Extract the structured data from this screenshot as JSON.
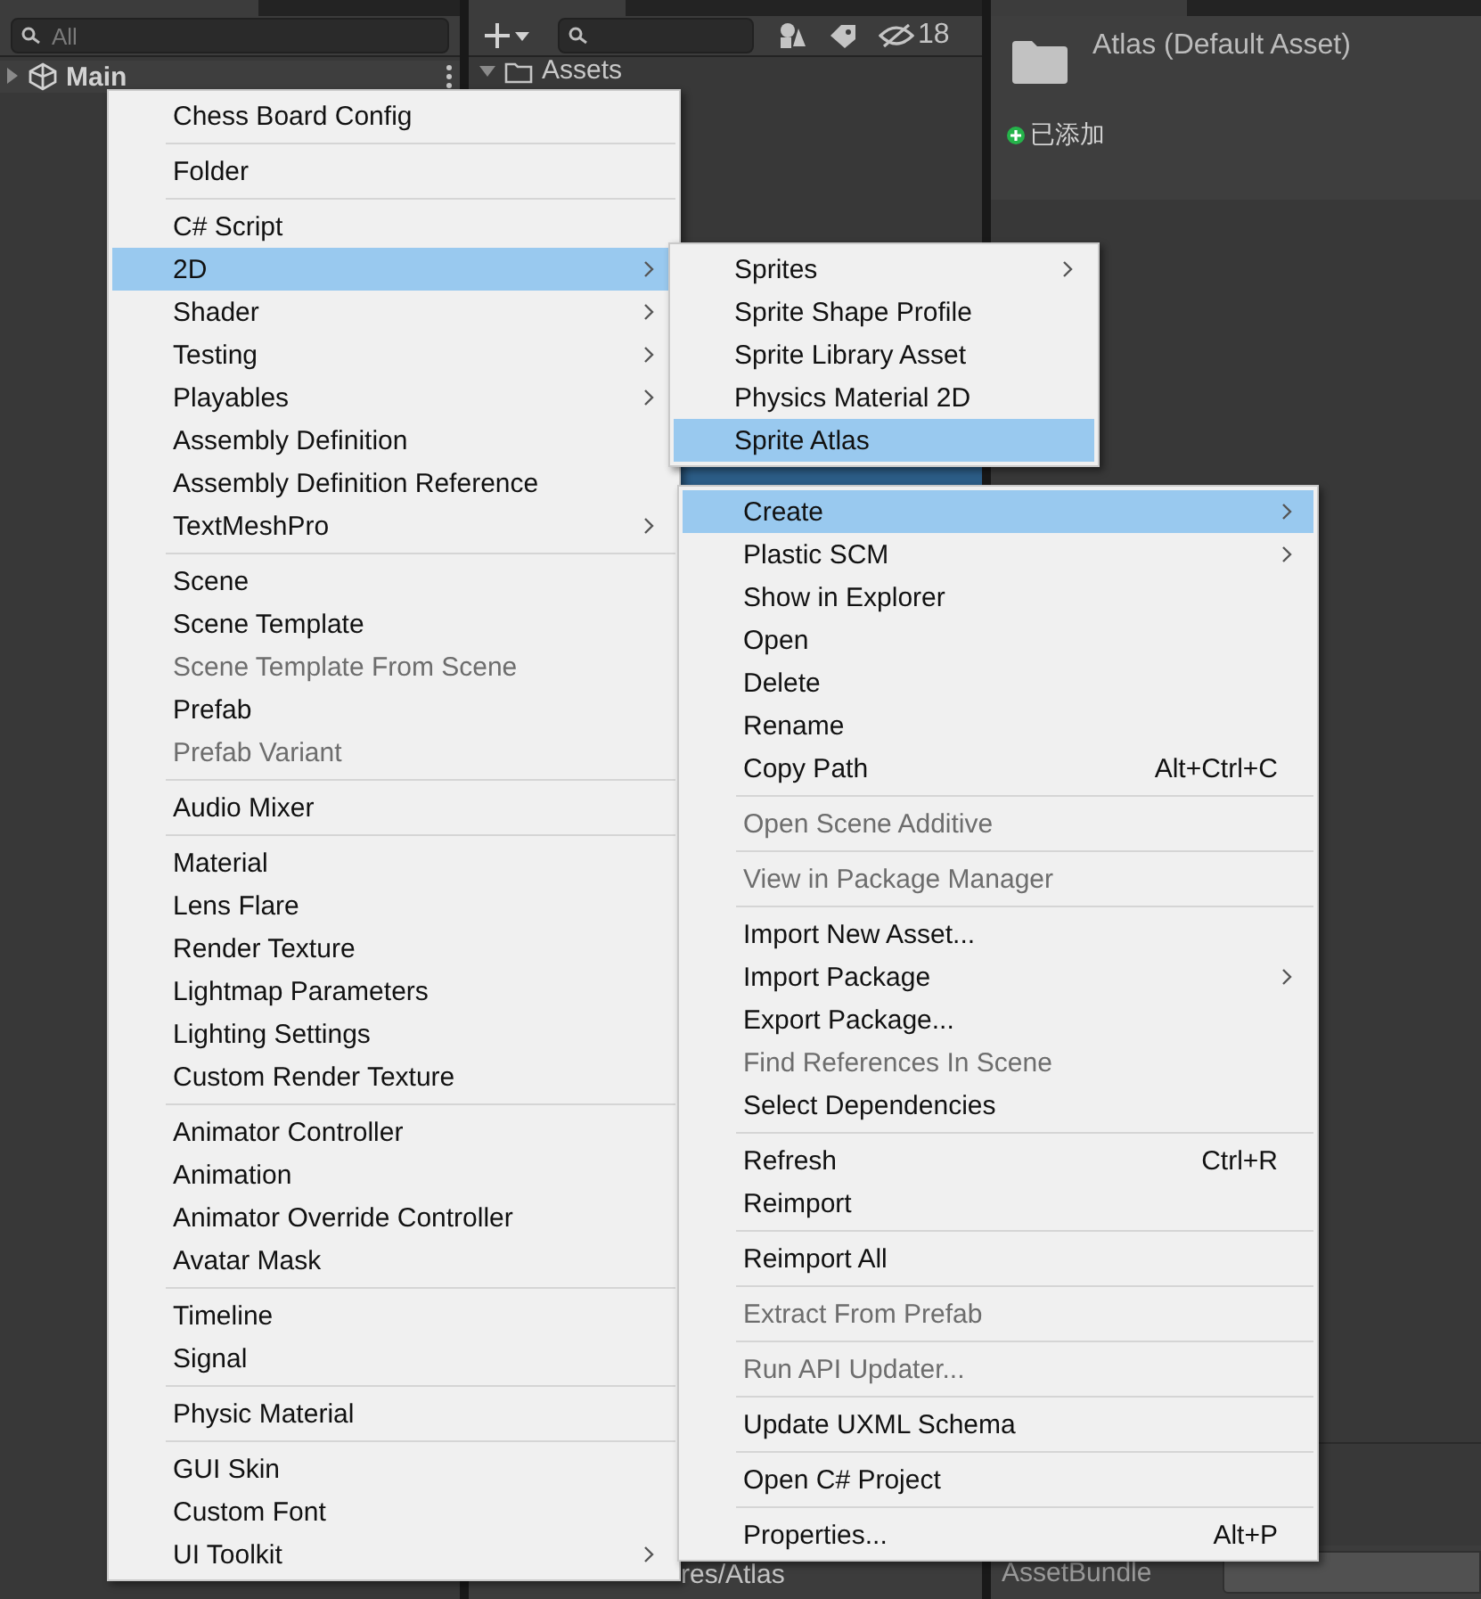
{
  "hierarchy": {
    "search": {
      "placeholder": "All"
    },
    "rows": [
      {
        "label": "Main",
        "expanded": false
      }
    ]
  },
  "project": {
    "toolbar": {
      "hidden_count": "18"
    },
    "tree": [
      {
        "label": "Assets",
        "expanded": true
      }
    ],
    "path": "res/Atlas"
  },
  "inspector": {
    "title": "Atlas (Default Asset)",
    "status": "已添加",
    "bundle_label": "AssetBundle"
  },
  "main_menu": {
    "groups": [
      {
        "items": [
          {
            "label": "Chess Board Config",
            "selected": false,
            "disabled": false,
            "submenu": false
          }
        ]
      },
      {
        "items": [
          {
            "label": "Folder",
            "selected": false,
            "disabled": false,
            "submenu": false
          }
        ]
      },
      {
        "items": [
          {
            "label": "C# Script",
            "selected": false,
            "disabled": false,
            "submenu": false
          },
          {
            "label": "2D",
            "selected": true,
            "disabled": false,
            "submenu": true
          },
          {
            "label": "Shader",
            "selected": false,
            "disabled": false,
            "submenu": true
          },
          {
            "label": "Testing",
            "selected": false,
            "disabled": false,
            "submenu": true
          },
          {
            "label": "Playables",
            "selected": false,
            "disabled": false,
            "submenu": true
          },
          {
            "label": "Assembly Definition",
            "selected": false,
            "disabled": false,
            "submenu": false
          },
          {
            "label": "Assembly Definition Reference",
            "selected": false,
            "disabled": false,
            "submenu": false
          },
          {
            "label": "TextMeshPro",
            "selected": false,
            "disabled": false,
            "submenu": true
          }
        ]
      },
      {
        "items": [
          {
            "label": "Scene",
            "selected": false,
            "disabled": false,
            "submenu": false
          },
          {
            "label": "Scene Template",
            "selected": false,
            "disabled": false,
            "submenu": false
          },
          {
            "label": "Scene Template From Scene",
            "selected": false,
            "disabled": true,
            "submenu": false
          },
          {
            "label": "Prefab",
            "selected": false,
            "disabled": false,
            "submenu": false
          },
          {
            "label": "Prefab Variant",
            "selected": false,
            "disabled": true,
            "submenu": false
          }
        ]
      },
      {
        "items": [
          {
            "label": "Audio Mixer",
            "selected": false,
            "disabled": false,
            "submenu": false
          }
        ]
      },
      {
        "items": [
          {
            "label": "Material",
            "selected": false,
            "disabled": false,
            "submenu": false
          },
          {
            "label": "Lens Flare",
            "selected": false,
            "disabled": false,
            "submenu": false
          },
          {
            "label": "Render Texture",
            "selected": false,
            "disabled": false,
            "submenu": false
          },
          {
            "label": "Lightmap Parameters",
            "selected": false,
            "disabled": false,
            "submenu": false
          },
          {
            "label": "Lighting Settings",
            "selected": false,
            "disabled": false,
            "submenu": false
          },
          {
            "label": "Custom Render Texture",
            "selected": false,
            "disabled": false,
            "submenu": false
          }
        ]
      },
      {
        "items": [
          {
            "label": "Animator Controller",
            "selected": false,
            "disabled": false,
            "submenu": false
          },
          {
            "label": "Animation",
            "selected": false,
            "disabled": false,
            "submenu": false
          },
          {
            "label": "Animator Override Controller",
            "selected": false,
            "disabled": false,
            "submenu": false
          },
          {
            "label": "Avatar Mask",
            "selected": false,
            "disabled": false,
            "submenu": false
          }
        ]
      },
      {
        "items": [
          {
            "label": "Timeline",
            "selected": false,
            "disabled": false,
            "submenu": false
          },
          {
            "label": "Signal",
            "selected": false,
            "disabled": false,
            "submenu": false
          }
        ]
      },
      {
        "items": [
          {
            "label": "Physic Material",
            "selected": false,
            "disabled": false,
            "submenu": false
          }
        ]
      },
      {
        "items": [
          {
            "label": "GUI Skin",
            "selected": false,
            "disabled": false,
            "submenu": false
          },
          {
            "label": "Custom Font",
            "selected": false,
            "disabled": false,
            "submenu": false
          },
          {
            "label": "UI Toolkit",
            "selected": false,
            "disabled": false,
            "submenu": true
          }
        ]
      }
    ]
  },
  "submenu_2d": {
    "groups": [
      {
        "items": [
          {
            "label": "Sprites",
            "selected": false,
            "disabled": false,
            "submenu": true
          },
          {
            "label": "Sprite Shape Profile",
            "selected": false,
            "disabled": false,
            "submenu": false
          },
          {
            "label": "Sprite Library Asset",
            "selected": false,
            "disabled": false,
            "submenu": false
          },
          {
            "label": "Physics Material 2D",
            "selected": false,
            "disabled": false,
            "submenu": false
          },
          {
            "label": "Sprite Atlas",
            "selected": true,
            "disabled": false,
            "submenu": false
          }
        ]
      }
    ]
  },
  "context_menu": {
    "groups": [
      {
        "items": [
          {
            "label": "Create",
            "selected": true,
            "disabled": false,
            "submenu": true
          },
          {
            "label": "Plastic SCM",
            "selected": false,
            "disabled": false,
            "submenu": true
          },
          {
            "label": "Show in Explorer",
            "selected": false,
            "disabled": false,
            "submenu": false
          },
          {
            "label": "Open",
            "selected": false,
            "disabled": false,
            "submenu": false
          },
          {
            "label": "Delete",
            "selected": false,
            "disabled": false,
            "submenu": false
          },
          {
            "label": "Rename",
            "selected": false,
            "disabled": false,
            "submenu": false
          },
          {
            "label": "Copy Path",
            "selected": false,
            "disabled": false,
            "submenu": false,
            "shortcut": "Alt+Ctrl+C"
          }
        ]
      },
      {
        "items": [
          {
            "label": "Open Scene Additive",
            "selected": false,
            "disabled": true,
            "submenu": false
          }
        ]
      },
      {
        "items": [
          {
            "label": "View in Package Manager",
            "selected": false,
            "disabled": true,
            "submenu": false
          }
        ]
      },
      {
        "items": [
          {
            "label": "Import New Asset...",
            "selected": false,
            "disabled": false,
            "submenu": false
          },
          {
            "label": "Import Package",
            "selected": false,
            "disabled": false,
            "submenu": true
          },
          {
            "label": "Export Package...",
            "selected": false,
            "disabled": false,
            "submenu": false
          },
          {
            "label": "Find References In Scene",
            "selected": false,
            "disabled": true,
            "submenu": false
          },
          {
            "label": "Select Dependencies",
            "selected": false,
            "disabled": false,
            "submenu": false
          }
        ]
      },
      {
        "items": [
          {
            "label": "Refresh",
            "selected": false,
            "disabled": false,
            "submenu": false,
            "shortcut": "Ctrl+R"
          },
          {
            "label": "Reimport",
            "selected": false,
            "disabled": false,
            "submenu": false
          }
        ]
      },
      {
        "items": [
          {
            "label": "Reimport All",
            "selected": false,
            "disabled": false,
            "submenu": false
          }
        ]
      },
      {
        "items": [
          {
            "label": "Extract From Prefab",
            "selected": false,
            "disabled": true,
            "submenu": false
          }
        ]
      },
      {
        "items": [
          {
            "label": "Run API Updater...",
            "selected": false,
            "disabled": true,
            "submenu": false
          }
        ]
      },
      {
        "items": [
          {
            "label": "Update UXML Schema",
            "selected": false,
            "disabled": false,
            "submenu": false
          }
        ]
      },
      {
        "items": [
          {
            "label": "Open C# Project",
            "selected": false,
            "disabled": false,
            "submenu": false
          }
        ]
      },
      {
        "items": [
          {
            "label": "Properties...",
            "selected": false,
            "disabled": false,
            "submenu": false,
            "shortcut": "Alt+P"
          }
        ]
      }
    ]
  }
}
